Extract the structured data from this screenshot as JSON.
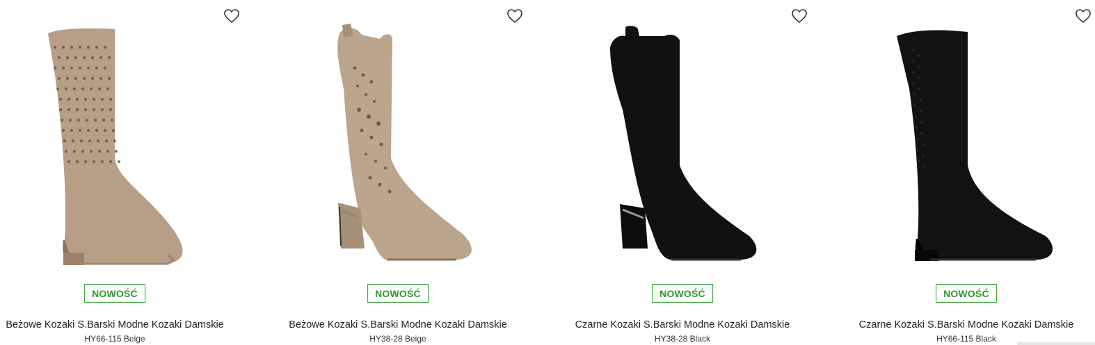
{
  "products": [
    {
      "badge": "NOWOŚĆ",
      "title": "Beżowe Kozaki S.Barski Modne Kozaki Damskie",
      "sku": "HY66-115 Beige",
      "color": "#b79e86",
      "icon": "boot-flat-perforated"
    },
    {
      "badge": "NOWOŚĆ",
      "title": "Beżowe Kozaki S.Barski Modne Kozaki Damskie",
      "sku": "HY38-28 Beige",
      "color": "#bca58d",
      "icon": "boot-heeled-western"
    },
    {
      "badge": "NOWOŚĆ",
      "title": "Czarne Kozaki S.Barski Modne Kozaki Damskie",
      "sku": "HY38-28 Black",
      "color": "#111111",
      "icon": "boot-heeled-western"
    },
    {
      "badge": "NOWOŚĆ",
      "title": "Czarne Kozaki S.Barski Modne Kozaki Damskie",
      "sku": "HY66-115 Black",
      "color": "#121212",
      "icon": "boot-flat-perforated"
    }
  ],
  "colors": {
    "badge_green": "#2b9a2b",
    "text": "#222222"
  },
  "icons": {
    "wishlist": "heart-outline-icon"
  }
}
